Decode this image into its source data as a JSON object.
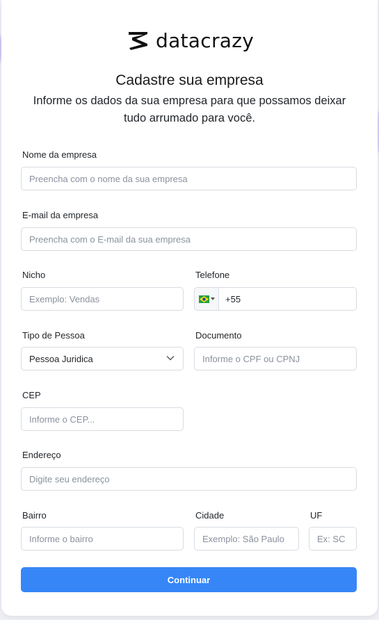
{
  "brand": {
    "name": "datacrazy"
  },
  "header": {
    "title": "Cadastre sua empresa",
    "subtitle": "Informe os dados da sua empresa para que possamos deixar tudo arrumado para você."
  },
  "form": {
    "company_name": {
      "label": "Nome da empresa",
      "placeholder": "Preencha com o nome da sua empresa"
    },
    "company_email": {
      "label": "E-mail da empresa",
      "placeholder": "Preencha com o E-mail da sua empresa"
    },
    "niche": {
      "label": "Nicho",
      "placeholder": "Exemplo: Vendas"
    },
    "phone": {
      "label": "Telefone",
      "country_code": "+55",
      "flag_icon": "brazil-flag-icon"
    },
    "person_type": {
      "label": "Tipo de Pessoa",
      "value": "Pessoa Juridica"
    },
    "document": {
      "label": "Documento",
      "placeholder": "Informe o CPF ou CPNJ"
    },
    "cep": {
      "label": "CEP",
      "placeholder": "Informe o CEP..."
    },
    "address": {
      "label": "Endereço",
      "placeholder": "Digite seu endereço"
    },
    "neighborhood": {
      "label": "Bairro",
      "placeholder": "Informe o bairro"
    },
    "city": {
      "label": "Cidade",
      "placeholder": "Exemplo: São Paulo"
    },
    "state": {
      "label": "UF",
      "placeholder": "Ex: SC"
    },
    "submit_label": "Continuar"
  },
  "colors": {
    "accent": "#3686f7",
    "border": "#d7dbe2",
    "text": "#1f2328",
    "placeholder": "#8a919c"
  }
}
